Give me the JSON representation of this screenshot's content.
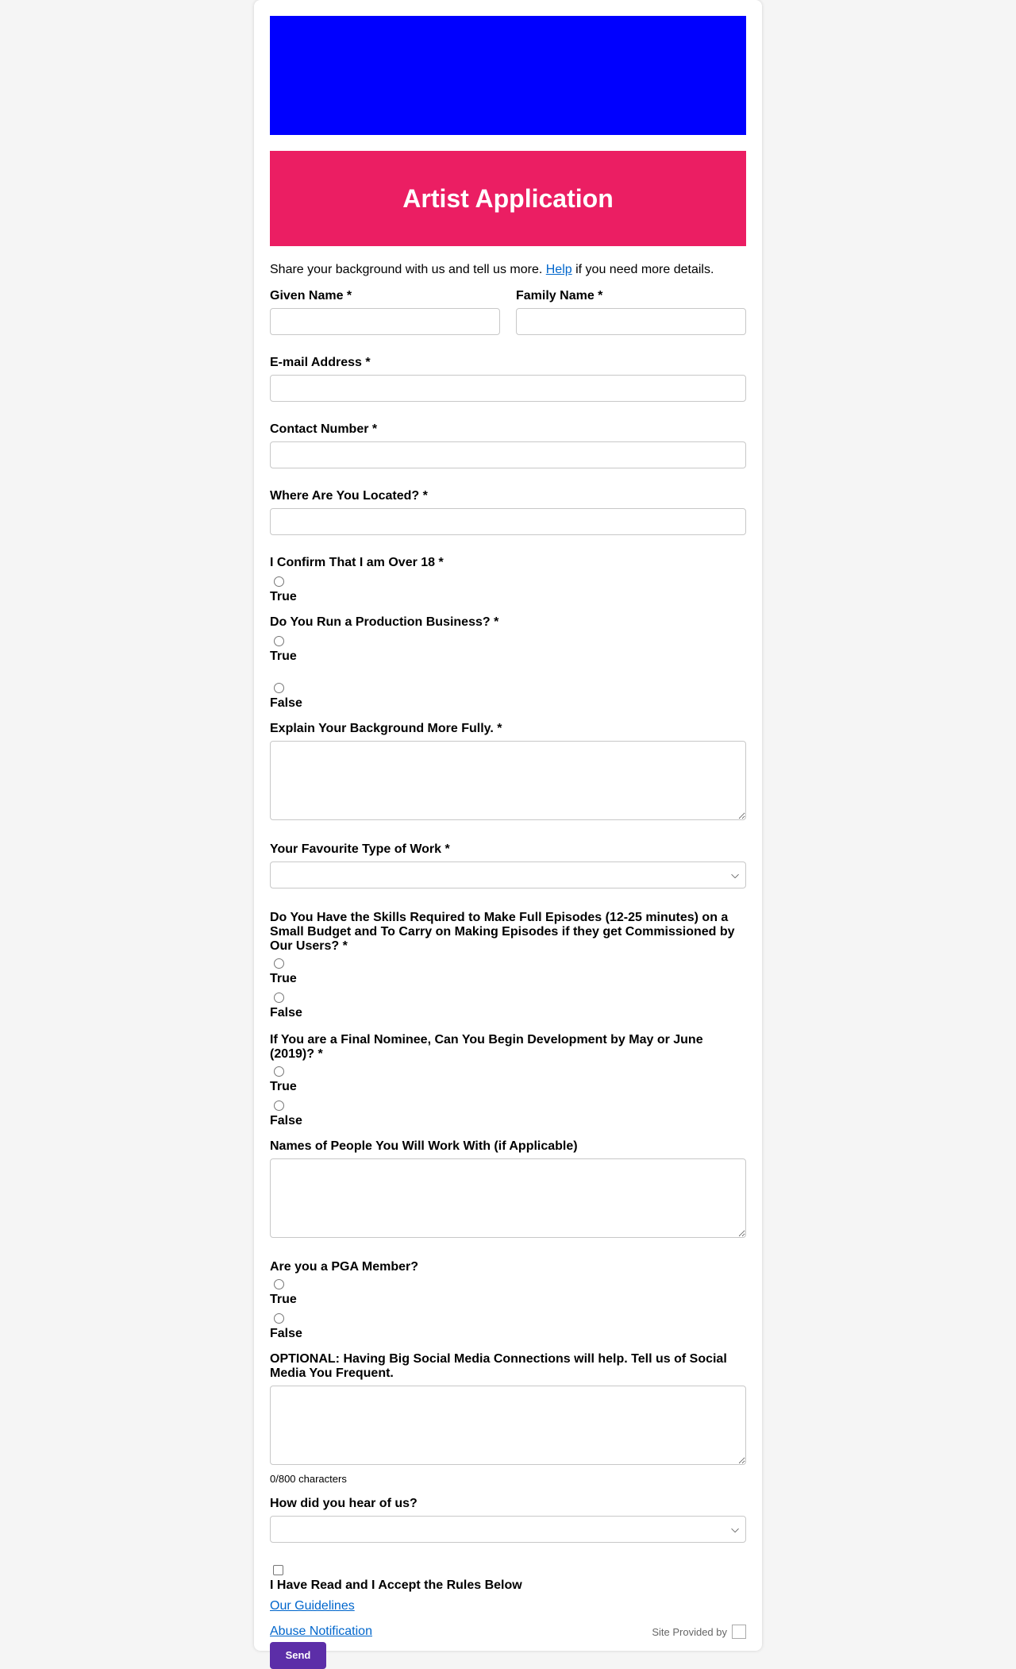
{
  "colors": {
    "banner_bg": "#0000ff",
    "title_bg": "#eb1e63",
    "link": "#0066cc",
    "send_bg": "#5c2ea8"
  },
  "form": {
    "title": "Artist Application",
    "intro_prefix": "Share your background with us and tell us more. ",
    "intro_link": "Help",
    "intro_suffix": " if you need more details.",
    "given_name_label": "Given Name *",
    "given_name_value": "",
    "family_name_label": "Family Name *",
    "family_name_value": "",
    "email_label": "E-mail Address *",
    "email_value": "",
    "contact_label": "Contact Number *",
    "contact_value": "",
    "location_label": "Where Are You Located? *",
    "location_value": "",
    "over18_label": "I Confirm That I am Over 18 *",
    "over18_true": "True",
    "production_label": "Do You Run a Production Business? *",
    "production_true": "True",
    "production_false": "False",
    "background_label": "Explain Your Background More Fully. *",
    "background_value": "",
    "work_type_label": "Your Favourite Type of Work *",
    "work_type_selected": "",
    "skills_label": "Do You Have the Skills Required to Make Full Episodes (12-25 minutes) on a Small Budget and To Carry on Making Episodes if they get Commissioned by Our Users? *",
    "skills_true": "True",
    "skills_false": "False",
    "nominee_label": "If You are a Final Nominee, Can You Begin Development by May or June (2019)? *",
    "nominee_true": "True",
    "nominee_false": "False",
    "people_label": "Names of People You Will Work With (if Applicable)",
    "people_value": "",
    "pga_label": "Are you a PGA Member?",
    "pga_true": "True",
    "pga_false": "False",
    "social_label": "OPTIONAL: Having Big Social Media Connections will help. Tell us of Social Media You Frequent.",
    "social_value": "",
    "social_counter": "0/800 characters",
    "hear_label": "How did you hear of us?",
    "hear_selected": "",
    "rules_label": "I Have Read and I Accept the Rules Below",
    "guidelines_link": "Our Guidelines",
    "abuse_link": "Abuse Notification",
    "provided_by": "Site Provided by",
    "send_label": "Send"
  }
}
